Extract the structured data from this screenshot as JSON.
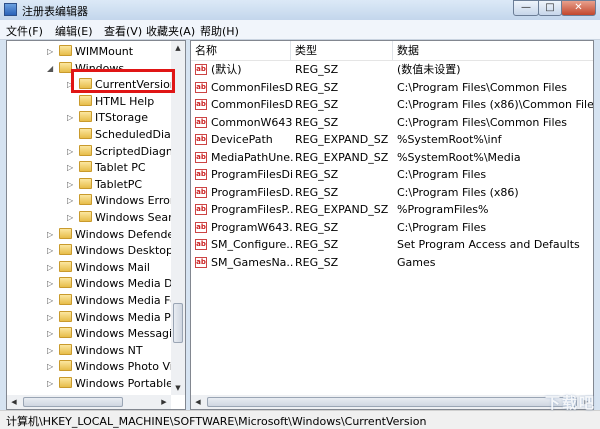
{
  "window": {
    "title": "注册表编辑器"
  },
  "controls": {
    "minimize": "—",
    "maximize": "□",
    "close": "✕"
  },
  "menu": [
    "文件(F)",
    "编辑(E)",
    "查看(V)",
    "收藏夹(A)",
    "帮助(H)"
  ],
  "tree": [
    {
      "label": "WIMMount",
      "expander": "▷"
    },
    {
      "label": "Windows",
      "expander": "◢"
    },
    {
      "label": "CurrentVersion",
      "expander": "▷",
      "selected": true
    },
    {
      "label": "HTML Help",
      "expander": ""
    },
    {
      "label": "ITStorage",
      "expander": "▷"
    },
    {
      "label": "ScheduledDiagr",
      "expander": ""
    },
    {
      "label": "ScriptedDiagno",
      "expander": "▷"
    },
    {
      "label": "Tablet PC",
      "expander": "▷"
    },
    {
      "label": "TabletPC",
      "expander": "▷"
    },
    {
      "label": "Windows Error",
      "expander": "▷"
    },
    {
      "label": "Windows Searc",
      "expander": "▷"
    },
    {
      "label": "Windows Defender",
      "expander": "▷"
    },
    {
      "label": "Windows Desktop",
      "expander": "▷"
    },
    {
      "label": "Windows Mail",
      "expander": "▷"
    },
    {
      "label": "Windows Media D",
      "expander": "▷"
    },
    {
      "label": "Windows Media Fo",
      "expander": "▷"
    },
    {
      "label": "Windows Media Pl",
      "expander": "▷"
    },
    {
      "label": "Windows Messagin",
      "expander": "▷"
    },
    {
      "label": "Windows NT",
      "expander": "▷"
    },
    {
      "label": "Windows Photo Vie",
      "expander": "▷"
    },
    {
      "label": "Windows Portable",
      "expander": "▷"
    }
  ],
  "columns": {
    "name": "名称",
    "type": "类型",
    "data": "数据"
  },
  "values": [
    {
      "name": "(默认)",
      "type": "REG_SZ",
      "data": "(数值未设置)"
    },
    {
      "name": "CommonFilesDir",
      "type": "REG_SZ",
      "data": "C:\\Program Files\\Common Files"
    },
    {
      "name": "CommonFilesD...",
      "type": "REG_SZ",
      "data": "C:\\Program Files (x86)\\Common Files"
    },
    {
      "name": "CommonW643...",
      "type": "REG_SZ",
      "data": "C:\\Program Files\\Common Files"
    },
    {
      "name": "DevicePath",
      "type": "REG_EXPAND_SZ",
      "data": "%SystemRoot%\\inf"
    },
    {
      "name": "MediaPathUne...",
      "type": "REG_EXPAND_SZ",
      "data": "%SystemRoot%\\Media"
    },
    {
      "name": "ProgramFilesDir",
      "type": "REG_SZ",
      "data": "C:\\Program Files"
    },
    {
      "name": "ProgramFilesD...",
      "type": "REG_SZ",
      "data": "C:\\Program Files (x86)"
    },
    {
      "name": "ProgramFilesP...",
      "type": "REG_EXPAND_SZ",
      "data": "%ProgramFiles%"
    },
    {
      "name": "ProgramW643...",
      "type": "REG_SZ",
      "data": "C:\\Program Files"
    },
    {
      "name": "SM_Configure...",
      "type": "REG_SZ",
      "data": "Set Program Access and Defaults"
    },
    {
      "name": "SM_GamesNa...",
      "type": "REG_SZ",
      "data": "Games"
    }
  ],
  "status": "计算机\\HKEY_LOCAL_MACHINE\\SOFTWARE\\Microsoft\\Windows\\CurrentVersion",
  "watermark": "下载吧",
  "scroll": {
    "left": "◀",
    "right": "▶",
    "up": "▲",
    "down": "▼"
  },
  "value_icon": "ab",
  "colors": {
    "highlight_box": "#e01515",
    "folder": "#e7bd4a"
  }
}
